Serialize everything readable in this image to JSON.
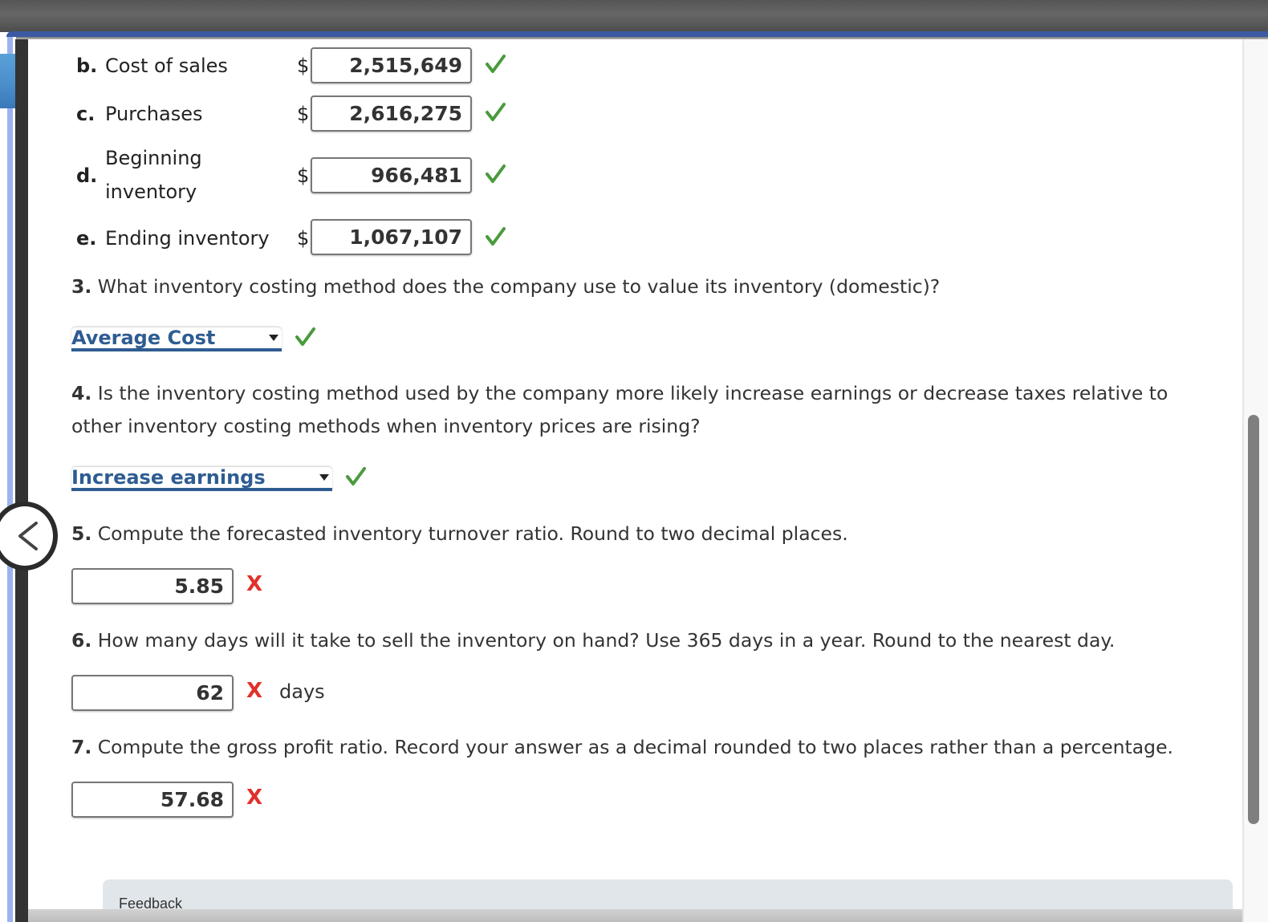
{
  "items": [
    {
      "letter": "b.",
      "label": "Cost of sales",
      "currency": "$",
      "value": "2,515,649",
      "status": "correct"
    },
    {
      "letter": "c.",
      "label": "Purchases",
      "currency": "$",
      "value": "2,616,275",
      "status": "correct"
    },
    {
      "letter": "d.",
      "label_line1": "Beginning",
      "label_line2": "inventory",
      "currency": "$",
      "value": "966,481",
      "status": "correct"
    },
    {
      "letter": "e.",
      "label": "Ending inventory",
      "currency": "$",
      "value": "1,067,107",
      "status": "correct"
    }
  ],
  "questions": [
    {
      "number": "3.",
      "text": "What inventory costing method does the company use to value its inventory (domestic)?",
      "answer": "Average Cost",
      "status": "correct"
    },
    {
      "number": "4.",
      "text_line1": "Is the inventory costing method used by the company more likely increase earnings or decrease taxes relative to",
      "text_line2": "other inventory costing methods when inventory prices are rising?",
      "answer": "Increase earnings",
      "status": "correct"
    },
    {
      "number": "5.",
      "text": "Compute the forecasted inventory turnover ratio. Round to two decimal places.",
      "answer": "5.85",
      "status": "incorrect",
      "status_mark": "X"
    },
    {
      "number": "6.",
      "text": "How many days will it take to sell the inventory on hand? Use 365 days in a year. Round to the nearest day.",
      "answer": "62",
      "status": "incorrect",
      "status_mark": "X",
      "unit": "days"
    },
    {
      "number": "7.",
      "text": "Compute the gross profit ratio. Record your answer as a decimal rounded to two places rather than a percentage.",
      "answer": "57.68",
      "status": "incorrect",
      "status_mark": "X"
    }
  ],
  "feedback": {
    "label": "Feedback"
  },
  "colors": {
    "correct": "#4a9a3c",
    "incorrect": "#e0322b",
    "select_accent": "#2e5c92",
    "header_rule": "#3b5aa3"
  }
}
